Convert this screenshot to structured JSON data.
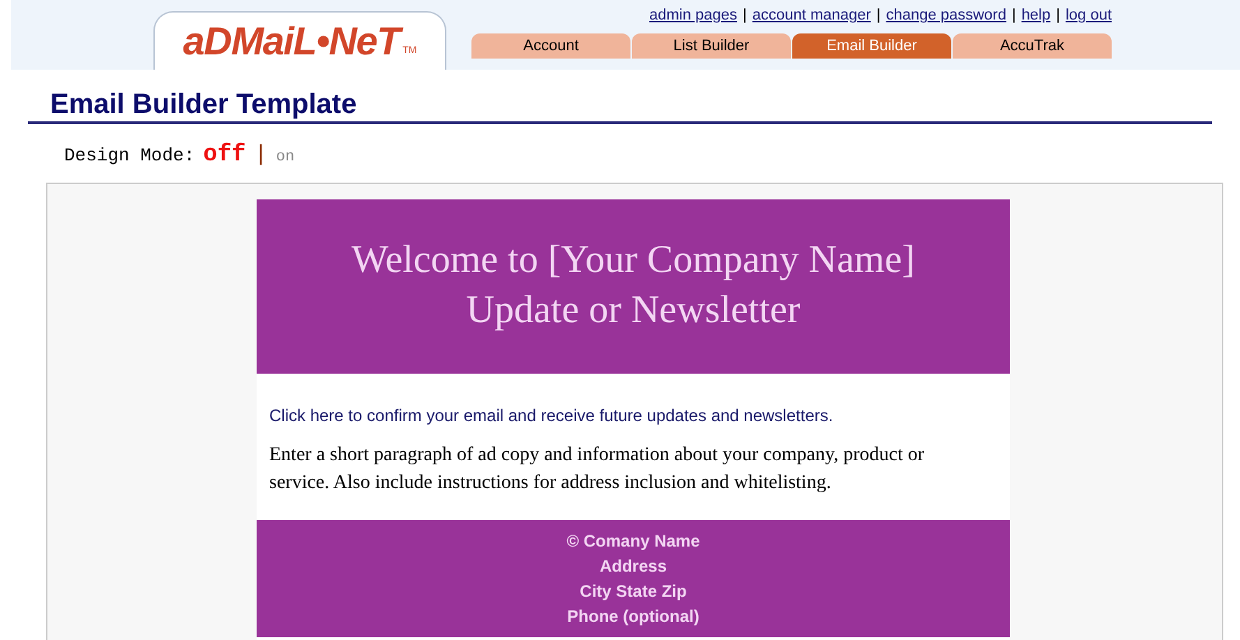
{
  "logo": {
    "text": "aDMaiL•NeT",
    "mark": "TM"
  },
  "top_links": [
    "admin pages",
    "account manager",
    "change password",
    "help",
    "log out"
  ],
  "link_separator": "|",
  "tabs": [
    {
      "label": "Account",
      "selected": false
    },
    {
      "label": "List Builder",
      "selected": false
    },
    {
      "label": "Email Builder",
      "selected": true
    },
    {
      "label": "AccuTrak",
      "selected": false
    }
  ],
  "page_title": "Email Builder Template",
  "design_mode": {
    "label": "Design Mode:",
    "separator": "|",
    "options": [
      {
        "label": "off",
        "selected": true
      },
      {
        "label": "on",
        "selected": false
      }
    ]
  },
  "email": {
    "header_lines": [
      "Welcome to [Your Company Name]",
      "Update or Newsletter"
    ],
    "confirm_link": "Click here to confirm your email and receive future updates and newsletters.",
    "paragraph": "Enter a short paragraph of ad copy and information about your company, product or service. Also include instructions for address inclusion and whitelisting.",
    "footer_lines": [
      "© Comany Name",
      "Address",
      "City State Zip",
      "Phone (optional)"
    ]
  }
}
